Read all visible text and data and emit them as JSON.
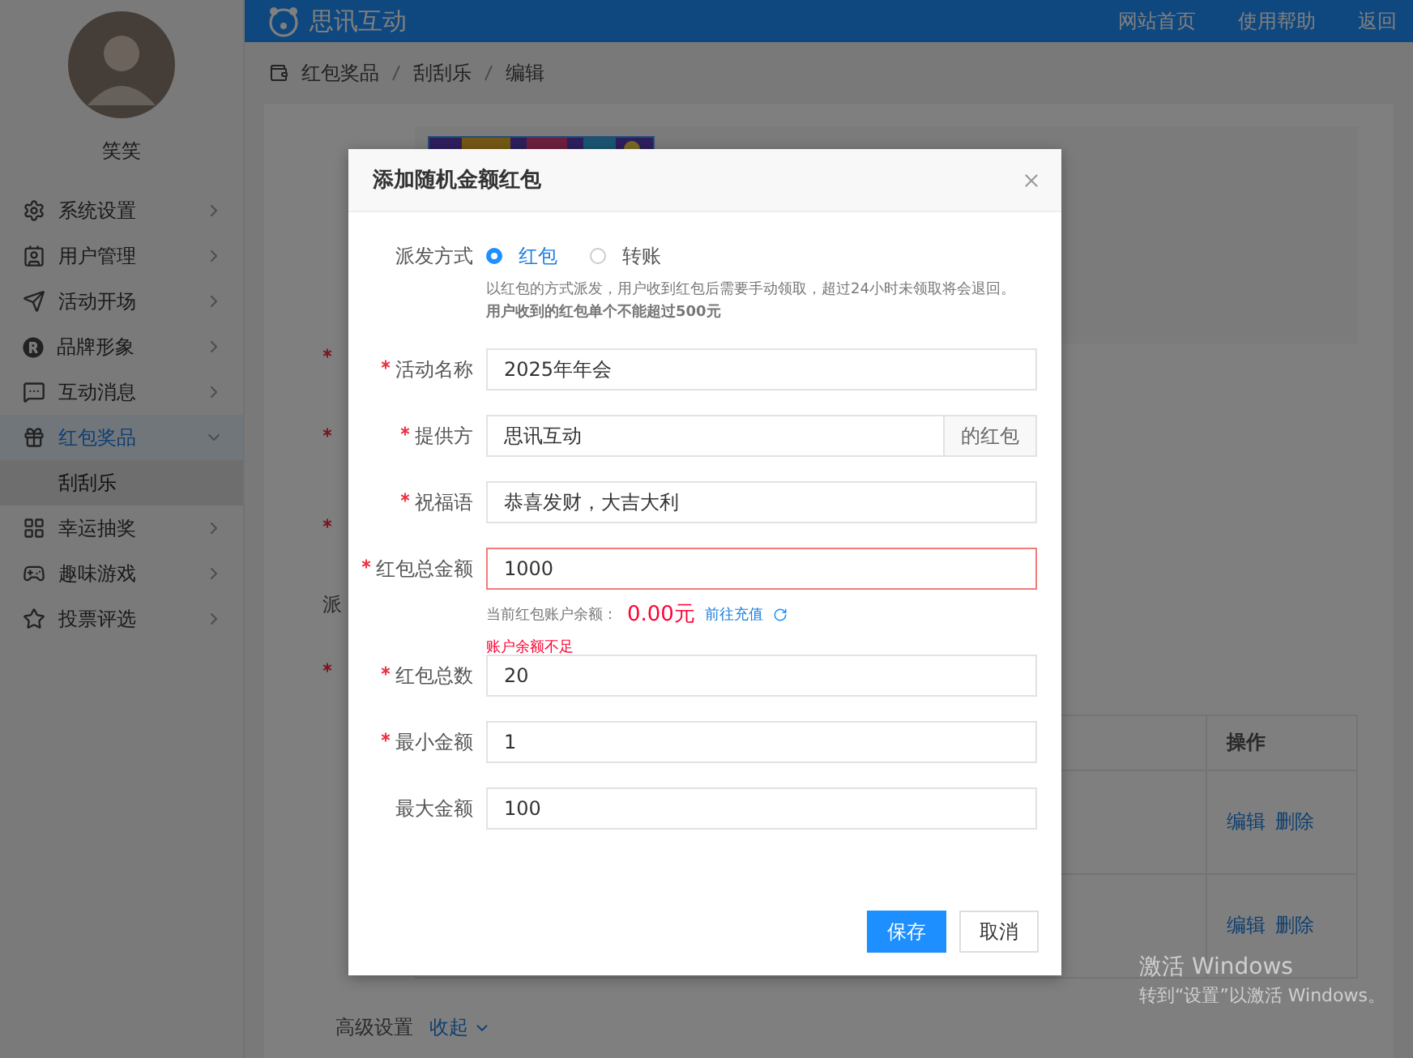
{
  "header": {
    "logo_text": "思讯互动",
    "links": [
      "网站首页",
      "使用帮助",
      "返回"
    ]
  },
  "sidebar": {
    "user_name": "笑笑",
    "items": [
      {
        "label": "系统设置",
        "selected": false,
        "expanded": false
      },
      {
        "label": "用户管理",
        "selected": false,
        "expanded": false
      },
      {
        "label": "活动开场",
        "selected": false,
        "expanded": false
      },
      {
        "label": "品牌形象",
        "selected": false,
        "expanded": false
      },
      {
        "label": "互动消息",
        "selected": false,
        "expanded": false
      },
      {
        "label": "红包奖品",
        "selected": true,
        "expanded": true,
        "children": [
          {
            "label": "刮刮乐",
            "selected": true
          }
        ]
      },
      {
        "label": "幸运抽奖",
        "selected": false,
        "expanded": false
      },
      {
        "label": "趣味游戏",
        "selected": false,
        "expanded": false
      },
      {
        "label": "投票评选",
        "selected": false,
        "expanded": false
      }
    ]
  },
  "breadcrumb": [
    "红包奖品",
    "刮刮乐",
    "编辑"
  ],
  "form": {
    "labels": [
      {
        "required": false
      },
      {
        "required": true
      },
      {
        "required": true
      },
      {
        "required": true
      },
      {
        "text": "派",
        "required": false
      },
      {
        "required": true
      }
    ],
    "table": {
      "header": "操作",
      "rows": [
        {
          "actions": [
            "编辑",
            "删除"
          ]
        },
        {
          "actions": [
            "编辑",
            "删除"
          ]
        }
      ]
    },
    "advanced": {
      "label": "高级设置",
      "toggle": "收起"
    }
  },
  "dialog": {
    "title": "添加随机金额红包",
    "fields": [
      {
        "kind": "radio",
        "label": "派发方式",
        "required": false,
        "options": [
          {
            "label": "红包",
            "selected": true
          },
          {
            "label": "转账",
            "selected": false
          }
        ],
        "hint": "以红包的方式派发，用户收到红包后需要手动领取，超过24小时未领取将会退回。**用户收到的红包单个不能超过500元**"
      },
      {
        "kind": "input",
        "label": "活动名称",
        "required": true,
        "value": "2025年年会",
        "error": false
      },
      {
        "kind": "append",
        "label": "提供方",
        "required": true,
        "value": "思讯互动",
        "append": "的红包",
        "error": false
      },
      {
        "kind": "input",
        "label": "祝福语",
        "required": true,
        "value": "恭喜发财，大吉大利",
        "error": false
      },
      {
        "kind": "input",
        "label": "红包总金额",
        "required": true,
        "value": "1000",
        "error": true,
        "balance_label": "当前红包账户余额：",
        "balance": "0.00元",
        "recharge": "前往充值",
        "error_text": "账户余额不足"
      },
      {
        "kind": "input",
        "label": "红包总数",
        "required": true,
        "value": "20",
        "error": false
      },
      {
        "kind": "input",
        "label": "最小金额",
        "required": true,
        "value": "1",
        "error": false
      },
      {
        "kind": "input",
        "label": "最大金额",
        "required": false,
        "value": "100",
        "error": false
      }
    ],
    "buttons": [
      {
        "label": "保存",
        "primary": true
      },
      {
        "label": "取消",
        "primary": false
      }
    ]
  },
  "os_notice": {
    "title": "激活 Windows",
    "text": "转到“设置”以激活 Windows。"
  }
}
